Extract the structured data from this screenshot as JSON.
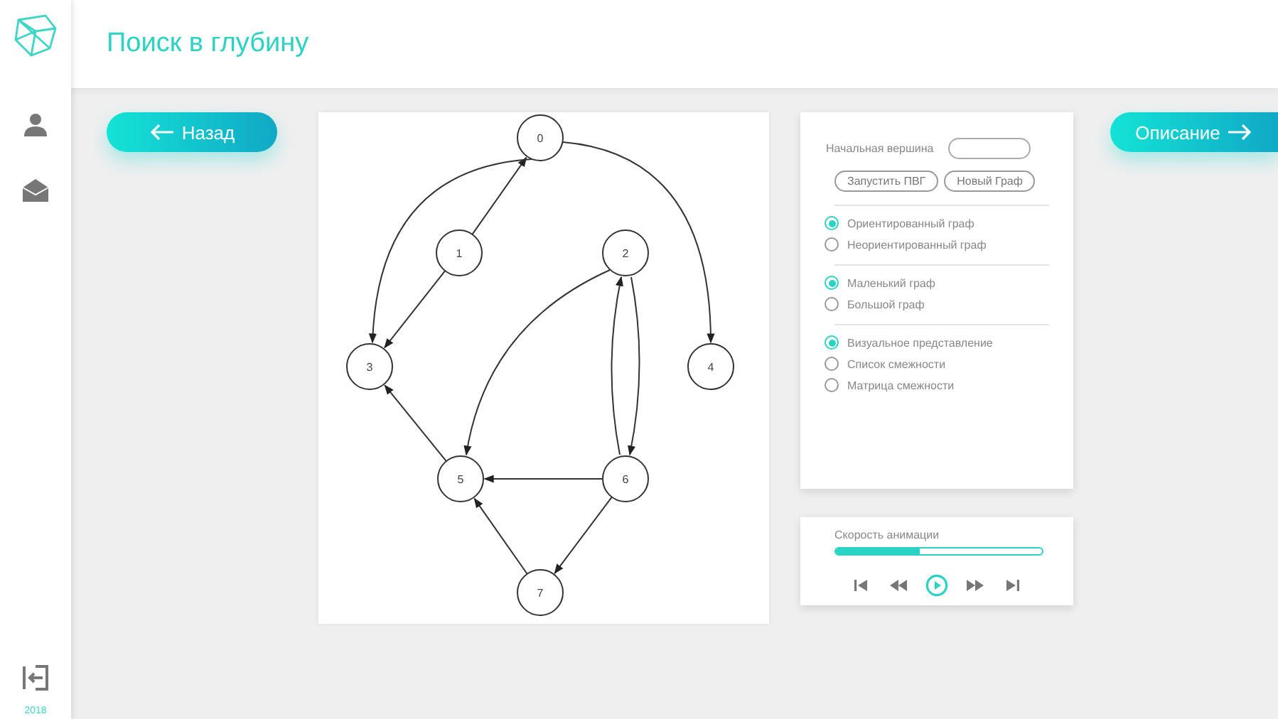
{
  "app": {
    "title": "Поиск в глубину",
    "year": "2018"
  },
  "nav": {
    "back": "Назад",
    "next": "Описание"
  },
  "graph": {
    "nodes": [
      {
        "label": "0"
      },
      {
        "label": "1"
      },
      {
        "label": "2"
      },
      {
        "label": "3"
      },
      {
        "label": "4"
      },
      {
        "label": "5"
      },
      {
        "label": "6"
      },
      {
        "label": "7"
      }
    ]
  },
  "settings": {
    "start_vertex": {
      "label": "Начальная вершина"
    },
    "buttons": [
      "Запустить ПВГ",
      "Новый Граф"
    ],
    "groups": [
      [
        {
          "label": "Ориентированный граф",
          "selected": true
        },
        {
          "label": "Неориентированный граф",
          "selected": false
        }
      ],
      [
        {
          "label": "Маленький граф",
          "selected": true
        },
        {
          "label": "Большой граф",
          "selected": false
        }
      ],
      [
        {
          "label": "Визуальное представление",
          "selected": true
        },
        {
          "label": "Список смежности",
          "selected": false
        },
        {
          "label": "Матрица смежности",
          "selected": false
        }
      ]
    ]
  },
  "animation": {
    "label": "Скорость анимации",
    "level": 0.41
  }
}
